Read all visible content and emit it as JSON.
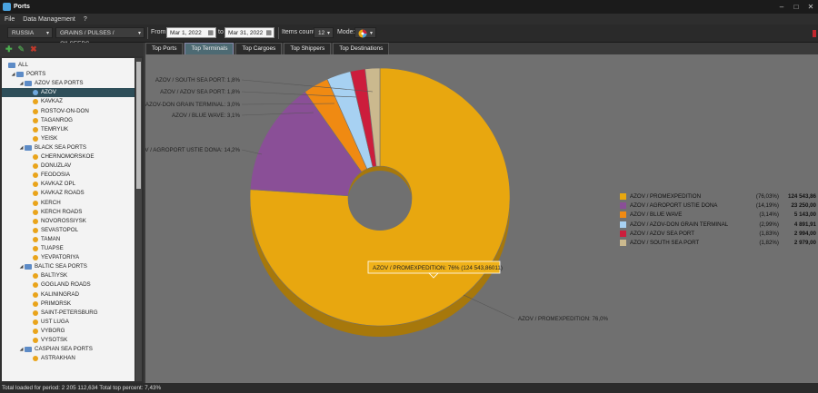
{
  "window": {
    "title": "Ports"
  },
  "menu": [
    "File",
    "Data Management",
    "?"
  ],
  "toolbar": {
    "country": "RUSSIA",
    "cargo": "GRAINS / PULSES / OILSEEDS",
    "from_label": "From",
    "from_date": "Mar 1, 2022",
    "to_label": "to",
    "to_date": "Mar 31, 2022",
    "items_label": "Items count:",
    "items_count": "12",
    "mode_label": "Mode:"
  },
  "tabs": [
    "Top Ports",
    "Top Terminals",
    "Top Cargoes",
    "Top Shippers",
    "Top Destinations"
  ],
  "active_tab": 1,
  "tree": [
    {
      "label": "ALL",
      "level": 0,
      "icon": "folder-icon"
    },
    {
      "label": "PORTS",
      "level": 1,
      "icon": "folder-icon"
    },
    {
      "label": "AZOV SEA PORTS",
      "level": 2,
      "icon": "folder-icon"
    },
    {
      "label": "AZOV",
      "level": 3,
      "icon": "port-icon",
      "selected": true
    },
    {
      "label": "KAVKAZ",
      "level": 3,
      "icon": "port-icon"
    },
    {
      "label": "ROSTOV-ON-DON",
      "level": 3,
      "icon": "port-icon"
    },
    {
      "label": "TAGANROG",
      "level": 3,
      "icon": "port-icon"
    },
    {
      "label": "TEMRYUK",
      "level": 3,
      "icon": "port-icon"
    },
    {
      "label": "YEISK",
      "level": 3,
      "icon": "port-icon"
    },
    {
      "label": "BLACK SEA PORTS",
      "level": 2,
      "icon": "folder-icon"
    },
    {
      "label": "CHERNOMORSKOE",
      "level": 3,
      "icon": "port-icon"
    },
    {
      "label": "DONUZLAV",
      "level": 3,
      "icon": "port-icon"
    },
    {
      "label": "FEODOSIA",
      "level": 3,
      "icon": "port-icon"
    },
    {
      "label": "KAVKAZ OPL",
      "level": 3,
      "icon": "port-icon"
    },
    {
      "label": "KAVKAZ ROADS",
      "level": 3,
      "icon": "port-icon"
    },
    {
      "label": "KERCH",
      "level": 3,
      "icon": "port-icon"
    },
    {
      "label": "KERCH ROADS",
      "level": 3,
      "icon": "port-icon"
    },
    {
      "label": "NOVOROSSIYSK",
      "level": 3,
      "icon": "port-icon"
    },
    {
      "label": "SEVASTOPOL",
      "level": 3,
      "icon": "port-icon"
    },
    {
      "label": "TAMAN",
      "level": 3,
      "icon": "port-icon"
    },
    {
      "label": "TUAPSE",
      "level": 3,
      "icon": "port-icon"
    },
    {
      "label": "YEVPATORIYA",
      "level": 3,
      "icon": "port-icon"
    },
    {
      "label": "BALTIC SEA PORTS",
      "level": 2,
      "icon": "folder-icon"
    },
    {
      "label": "BALTIYSK",
      "level": 3,
      "icon": "port-icon"
    },
    {
      "label": "GOGLAND ROADS",
      "level": 3,
      "icon": "port-icon"
    },
    {
      "label": "KALININGRAD",
      "level": 3,
      "icon": "port-icon"
    },
    {
      "label": "PRIMORSK",
      "level": 3,
      "icon": "port-icon"
    },
    {
      "label": "SAINT-PETERSBURG",
      "level": 3,
      "icon": "port-icon"
    },
    {
      "label": "UST LUGA",
      "level": 3,
      "icon": "port-icon"
    },
    {
      "label": "VYBORG",
      "level": 3,
      "icon": "port-icon"
    },
    {
      "label": "VYSOTSK",
      "level": 3,
      "icon": "port-icon"
    },
    {
      "label": "CASPIAN SEA PORTS",
      "level": 2,
      "icon": "folder-icon"
    },
    {
      "label": "ASTRAKHAN",
      "level": 3,
      "icon": "port-icon"
    }
  ],
  "chart_data": {
    "type": "pie",
    "donut": true,
    "series": [
      {
        "name": "AZOV / PROMEXPEDITION",
        "pct": "(76,03%)",
        "value": "124 543,86",
        "share": 76.03,
        "color": "#e8a70f",
        "outside_label": "AZOV / PROMEXPEDITION: 76,0%"
      },
      {
        "name": "AZOV / AGROPORT USTIE DONA",
        "pct": "(14,19%)",
        "value": "23 250,00",
        "share": 14.19,
        "color": "#8a4f97",
        "outside_label": "OV / AGROPORT USTIE DONA: 14,2%"
      },
      {
        "name": "AZOV / BLUE WAVE",
        "pct": "(3,14%)",
        "value": "5 143,00",
        "share": 3.14,
        "color": "#f08a12",
        "outside_label": "AZOV / BLUE WAVE: 3,1%"
      },
      {
        "name": "AZOV / AZOV-DON GRAIN TERMINAL",
        "pct": "(2,99%)",
        "value": "4 891,91",
        "share": 2.99,
        "color": "#a7d1f2",
        "outside_label": "AZOV-DON GRAIN TERMINAL: 3,0%"
      },
      {
        "name": "AZOV / AZOV SEA PORT",
        "pct": "(1,83%)",
        "value": "2 994,00",
        "share": 1.83,
        "color": "#cc1d3c",
        "outside_label": "AZOV / AZOV SEA PORT: 1,8%"
      },
      {
        "name": "AZOV / SOUTH SEA PORT",
        "pct": "(1,82%)",
        "value": "2 979,00",
        "share": 1.82,
        "color": "#cbb98e",
        "outside_label": "AZOV / SOUTH SEA PORT: 1,8%"
      }
    ],
    "tooltip": "AZOV / PROMEXPEDITION: 76% (124 543,86011)",
    "legend_position": "right"
  },
  "status": "Total loaded for period: 2 205 112,634 Total top percent: 7,43%"
}
